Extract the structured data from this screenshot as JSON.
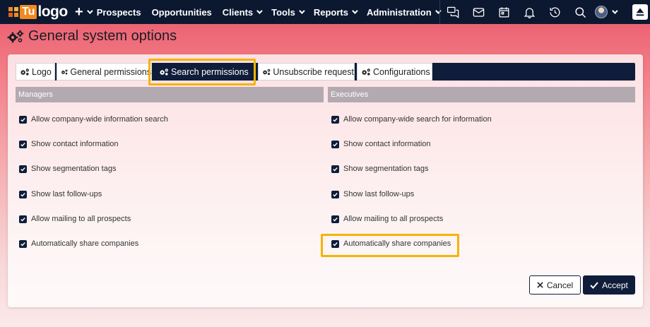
{
  "app": {
    "logo_text": "logo",
    "logo_badge": "Tu"
  },
  "nav": {
    "items": [
      {
        "label": "Prospects",
        "dropdown": false
      },
      {
        "label": "Opportunities",
        "dropdown": false
      },
      {
        "label": "Clients",
        "dropdown": true
      },
      {
        "label": "Tools",
        "dropdown": true
      },
      {
        "label": "Reports",
        "dropdown": true
      },
      {
        "label": "Administration",
        "dropdown": true
      }
    ],
    "icons": [
      "chat-icon",
      "mail-icon",
      "calendar-icon",
      "bell-icon",
      "history-icon",
      "search-icon",
      "avatar"
    ]
  },
  "page": {
    "title": "General system options"
  },
  "tabs": [
    {
      "label": "Logo",
      "active": false
    },
    {
      "label": "General permissions",
      "active": false
    },
    {
      "label": "Search permissions",
      "active": true
    },
    {
      "label": "Unsubscribe request",
      "active": false
    },
    {
      "label": "Configurations",
      "active": false
    }
  ],
  "managers": {
    "heading": "Managers",
    "options": [
      {
        "label": "Allow company-wide information search",
        "checked": true
      },
      {
        "label": "Show contact information",
        "checked": true
      },
      {
        "label": "Show segmentation tags",
        "checked": true
      },
      {
        "label": "Show last follow-ups",
        "checked": true
      },
      {
        "label": "Allow mailing to all prospects",
        "checked": true
      },
      {
        "label": "Automatically share companies",
        "checked": true
      }
    ]
  },
  "executives": {
    "heading": "Executives",
    "options": [
      {
        "label": "Allow company-wide search for information",
        "checked": true
      },
      {
        "label": "Show contact information",
        "checked": true
      },
      {
        "label": "Show segmentation tags",
        "checked": true
      },
      {
        "label": "Show last follow-ups",
        "checked": true
      },
      {
        "label": "Allow mailing to all prospects",
        "checked": true
      },
      {
        "label": "Automatically share companies",
        "checked": true
      }
    ]
  },
  "actions": {
    "cancel_label": "Cancel",
    "accept_label": "Accept"
  },
  "colors": {
    "navbar": "#0c1830",
    "primary": "#0f1d3a",
    "highlight": "#f4b400",
    "section_header": "#b3aab1",
    "logo_orange": "#f08a1f"
  }
}
